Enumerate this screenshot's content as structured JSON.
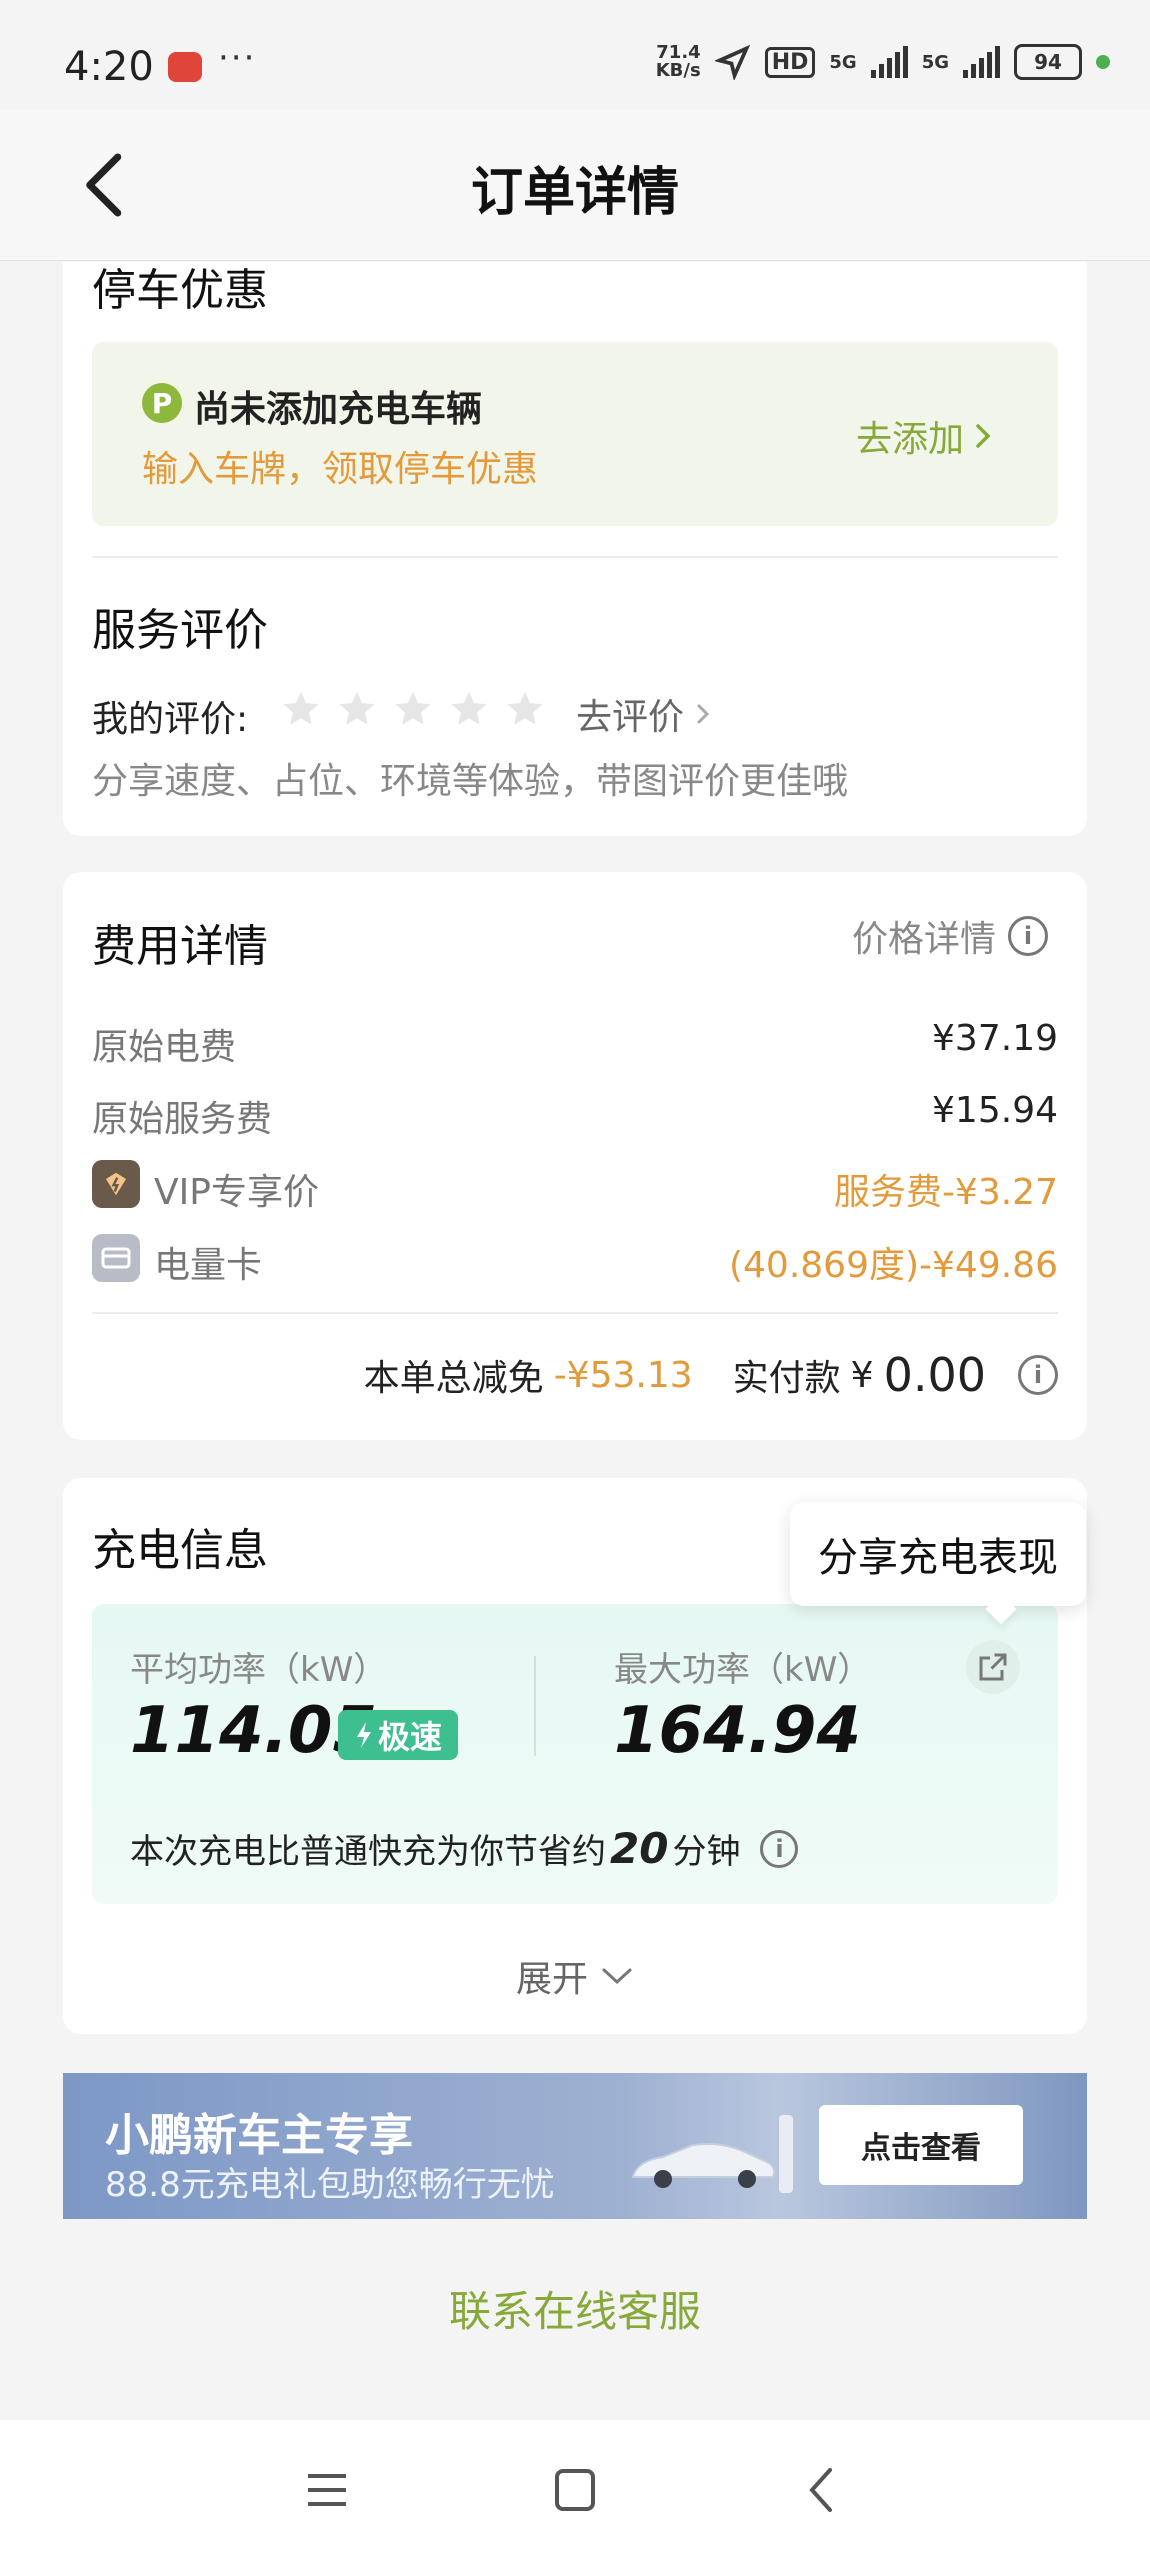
{
  "status": {
    "time": "4:20",
    "dots": "···",
    "speed_top": "71.4",
    "speed_unit": "KB/s",
    "hd": "HD",
    "net1": "5G",
    "net2": "5G",
    "battery": "94"
  },
  "header": {
    "title": "订单详情"
  },
  "parking": {
    "section_title": "停车优惠",
    "icon_letter": "P",
    "title": "尚未添加充电车辆",
    "subtitle": "输入车牌，领取停车优惠",
    "link": "去添加"
  },
  "review": {
    "section_title": "服务评价",
    "my_label": "我的评价:",
    "link": "去评价",
    "hint": "分享速度、占位、环境等体验，带图评价更佳哦",
    "rating": 0,
    "max_rating": 5
  },
  "fees": {
    "section_title": "费用详情",
    "price_detail": "价格详情",
    "rows": [
      {
        "label": "原始电费",
        "value": "¥37.19"
      },
      {
        "label": "原始服务费",
        "value": "¥15.94"
      },
      {
        "label": "VIP专享价",
        "value": "服务费-¥3.27"
      },
      {
        "label": "电量卡",
        "value": "(40.869度)-¥49.86"
      }
    ],
    "total_discount_label": "本单总减免",
    "total_discount": "-¥53.13",
    "paid_label": "实付款",
    "paid_currency": "¥",
    "paid_value": "0.00"
  },
  "charging": {
    "section_title": "充电信息",
    "tooltip": "分享充电表现",
    "avg_label": "平均功率（kW）",
    "avg_value": "114.05",
    "badge": "极速",
    "max_label": "最大功率（kW）",
    "max_value": "164.94",
    "saving_prefix": "本次充电比普通快充为你节省约",
    "saving_value": "20",
    "saving_suffix": "分钟",
    "expand": "展开"
  },
  "banner": {
    "title": "小鹏新车主专享",
    "subtitle": "88.8元充电礼包助您畅行无忧",
    "button": "点击查看"
  },
  "contact": "联系在线客服",
  "colors": {
    "accent_green": "#86a93a",
    "orange": "#e39a3a",
    "badge_green": "#3dbf8f"
  }
}
